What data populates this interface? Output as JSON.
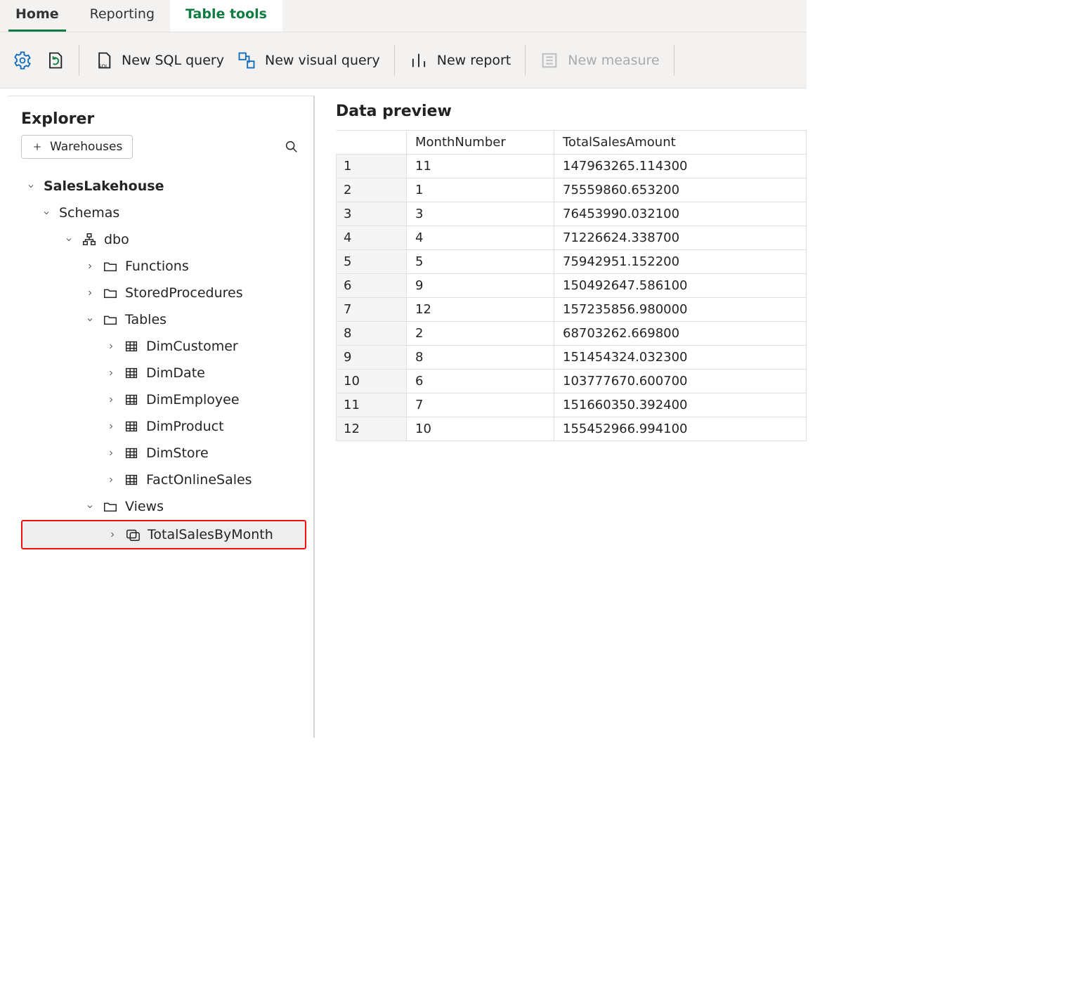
{
  "tabs": {
    "home": "Home",
    "reporting": "Reporting",
    "table_tools": "Table tools"
  },
  "ribbon": {
    "new_sql_query": "New SQL query",
    "new_visual_query": "New visual query",
    "new_report": "New report",
    "new_measure": "New measure"
  },
  "explorer": {
    "title": "Explorer",
    "warehouses_btn": "Warehouses",
    "tree": {
      "root": "SalesLakehouse",
      "schemas_label": "Schemas",
      "dbo_label": "dbo",
      "functions": "Functions",
      "stored_procedures": "StoredProcedures",
      "tables_label": "Tables",
      "tables": [
        "DimCustomer",
        "DimDate",
        "DimEmployee",
        "DimProduct",
        "DimStore",
        "FactOnlineSales"
      ],
      "views_label": "Views",
      "views": [
        "TotalSalesByMonth"
      ]
    }
  },
  "preview": {
    "title": "Data preview",
    "columns": [
      "MonthNumber",
      "TotalSalesAmount"
    ],
    "rows": [
      {
        "idx": "1",
        "MonthNumber": "11",
        "TotalSalesAmount": "147963265.114300"
      },
      {
        "idx": "2",
        "MonthNumber": "1",
        "TotalSalesAmount": "75559860.653200"
      },
      {
        "idx": "3",
        "MonthNumber": "3",
        "TotalSalesAmount": "76453990.032100"
      },
      {
        "idx": "4",
        "MonthNumber": "4",
        "TotalSalesAmount": "71226624.338700"
      },
      {
        "idx": "5",
        "MonthNumber": "5",
        "TotalSalesAmount": "75942951.152200"
      },
      {
        "idx": "6",
        "MonthNumber": "9",
        "TotalSalesAmount": "150492647.586100"
      },
      {
        "idx": "7",
        "MonthNumber": "12",
        "TotalSalesAmount": "157235856.980000"
      },
      {
        "idx": "8",
        "MonthNumber": "2",
        "TotalSalesAmount": "68703262.669800"
      },
      {
        "idx": "9",
        "MonthNumber": "8",
        "TotalSalesAmount": "151454324.032300"
      },
      {
        "idx": "10",
        "MonthNumber": "6",
        "TotalSalesAmount": "103777670.600700"
      },
      {
        "idx": "11",
        "MonthNumber": "7",
        "TotalSalesAmount": "151660350.392400"
      },
      {
        "idx": "12",
        "MonthNumber": "10",
        "TotalSalesAmount": "155452966.994100"
      }
    ]
  }
}
